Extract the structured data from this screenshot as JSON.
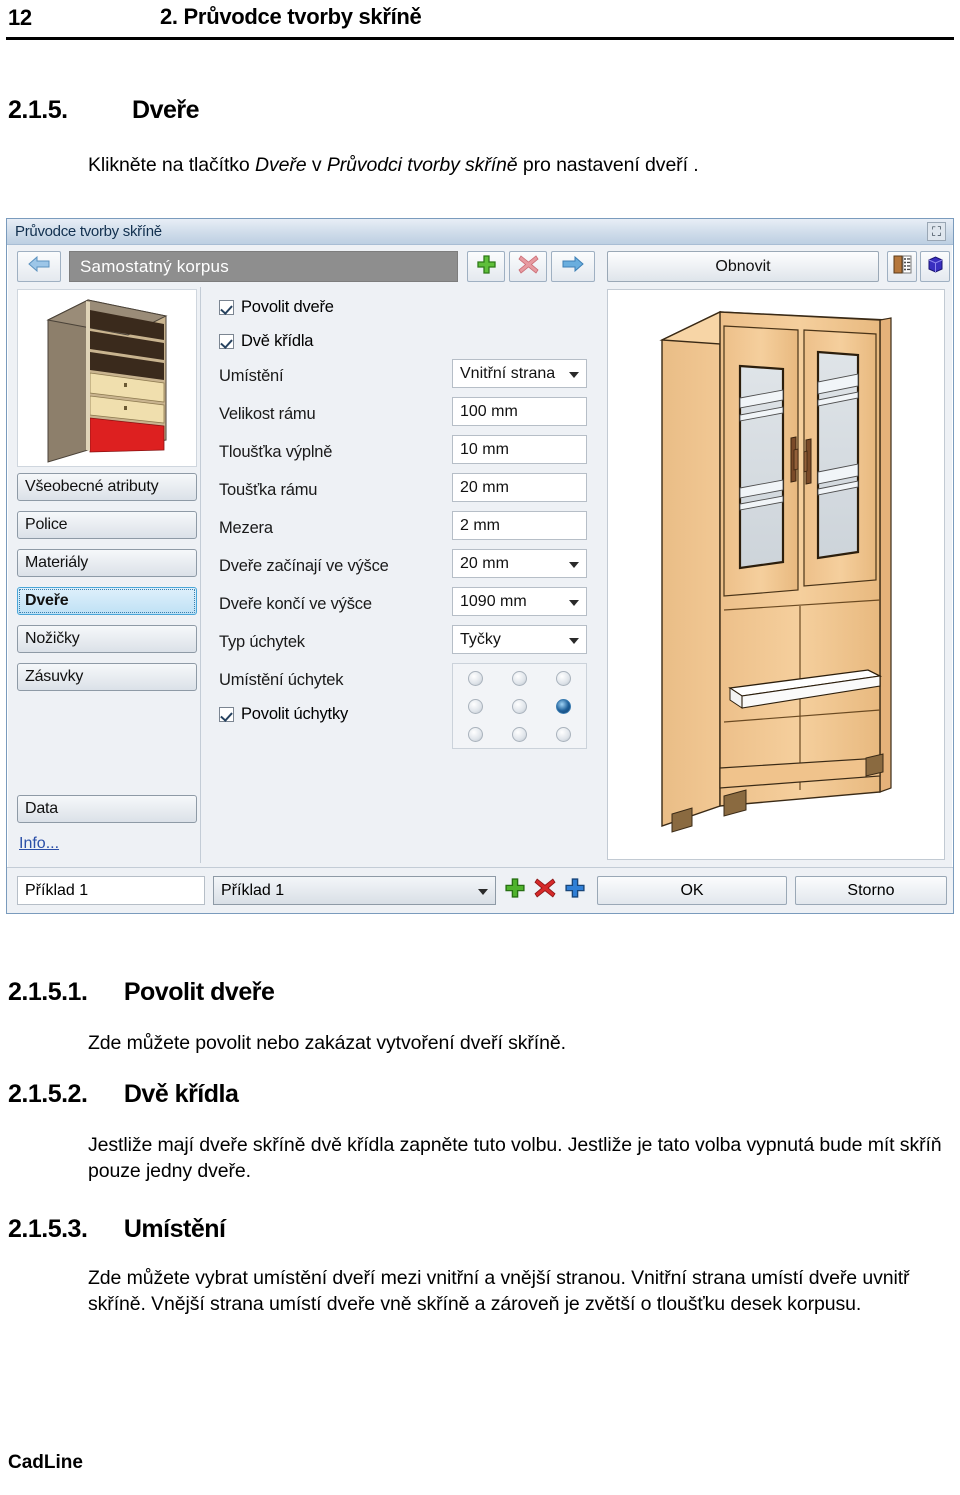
{
  "page": {
    "number": "12",
    "running_head": "2. Průvodce tvorby skříně",
    "footer_brand": "CadLine"
  },
  "sections": [
    {
      "number": "2.1.5.",
      "title": "Dveře",
      "body_html": "Klikněte na tlačítko <i>Dveře</i> v <i>Průvodci tvorby skříně</i> pro nastavení dveří ."
    },
    {
      "number": "2.1.5.1.",
      "title": "Povolit dveře",
      "body_html": "Zde můžete povolit nebo zakázat vytvoření dveří skříně."
    },
    {
      "number": "2.1.5.2.",
      "title": "Dvě křídla",
      "body_html": "Jestliže mají dveře skříně dvě křídla zapněte tuto volbu. Jestliže je tato volba vypnutá bude mít skříň pouze jedny dveře."
    },
    {
      "number": "2.1.5.3.",
      "title": "Umístění",
      "body_html": "Zde můžete vybrat umístění dveří mezi vnitřní a vnější stranou. Vnitřní strana umístí dveře uvnitř skříně. Vnější strana umístí dveře vně skříně a zároveň je zvětší o tloušťku desek korpusu."
    }
  ],
  "dialog": {
    "title": "Průvodce tvorby skříně",
    "close_icon": "close-icon",
    "toolbar": {
      "back_icon": "arrow-left-icon",
      "breadcrumb": "Samostatný korpus",
      "add_icon": "plus-green-icon",
      "delete_icon": "cross-red-icon",
      "forward_icon": "arrow-right-icon",
      "refresh_label": "Obnovit",
      "door_list_icon": "door-list-icon",
      "cube_3d_icon": "cube-3d-icon"
    },
    "sidebar": {
      "thumbnail_alt": "cabinet-preview-thumbnail",
      "items": [
        {
          "label": "Všeobecné atributy",
          "selected": false
        },
        {
          "label": "Police",
          "selected": false
        },
        {
          "label": "Materiály",
          "selected": false
        },
        {
          "label": "Dveře",
          "selected": true
        },
        {
          "label": "Nožičky",
          "selected": false
        },
        {
          "label": "Zásuvky",
          "selected": false
        }
      ],
      "data_button": "Data",
      "info_link": "Info..."
    },
    "form": {
      "checkbox_enable_doors": {
        "label": "Povolit dveře",
        "checked": true
      },
      "checkbox_two_wings": {
        "label": "Dvě křídla",
        "checked": true
      },
      "rows": [
        {
          "label": "Umístění",
          "value": "Vnitřní strana",
          "type": "combo"
        },
        {
          "label": "Velikost rámu",
          "value": "100 mm",
          "type": "text"
        },
        {
          "label": "Tloušťka výplně",
          "value": "10 mm",
          "type": "text"
        },
        {
          "label": "Toušťka rámu",
          "value": "20 mm",
          "type": "text"
        },
        {
          "label": "Mezera",
          "value": "2 mm",
          "type": "text"
        },
        {
          "label": "Dveře začínají ve výšce",
          "value": "20 mm",
          "type": "combo"
        },
        {
          "label": "Dveře končí ve výšce",
          "value": "1090 mm",
          "type": "combo"
        },
        {
          "label": "Typ úchytek",
          "value": "Tyčky",
          "type": "combo"
        }
      ],
      "handle_position": {
        "label": "Umístění úchytek",
        "selected_index": 5
      },
      "checkbox_enable_handles": {
        "label": "Povolit úchytky",
        "checked": true
      }
    },
    "preview": {
      "alt": "wardrobe-3d-preview"
    },
    "footer": {
      "name_value": "Příklad 1",
      "combo_value": "Příklad 1",
      "add_icon": "plus-green-icon",
      "delete_icon": "cross-red-icon",
      "duplicate_icon": "plus-blue-icon",
      "ok_label": "OK",
      "cancel_label": "Storno"
    }
  },
  "colors": {
    "accent": "#2b4fa8",
    "selected_item": "#bfe1f5",
    "breadcrumb_bg": "#8e8e8e",
    "wood": "#f0c080",
    "radio_on": "#1e5f99"
  }
}
